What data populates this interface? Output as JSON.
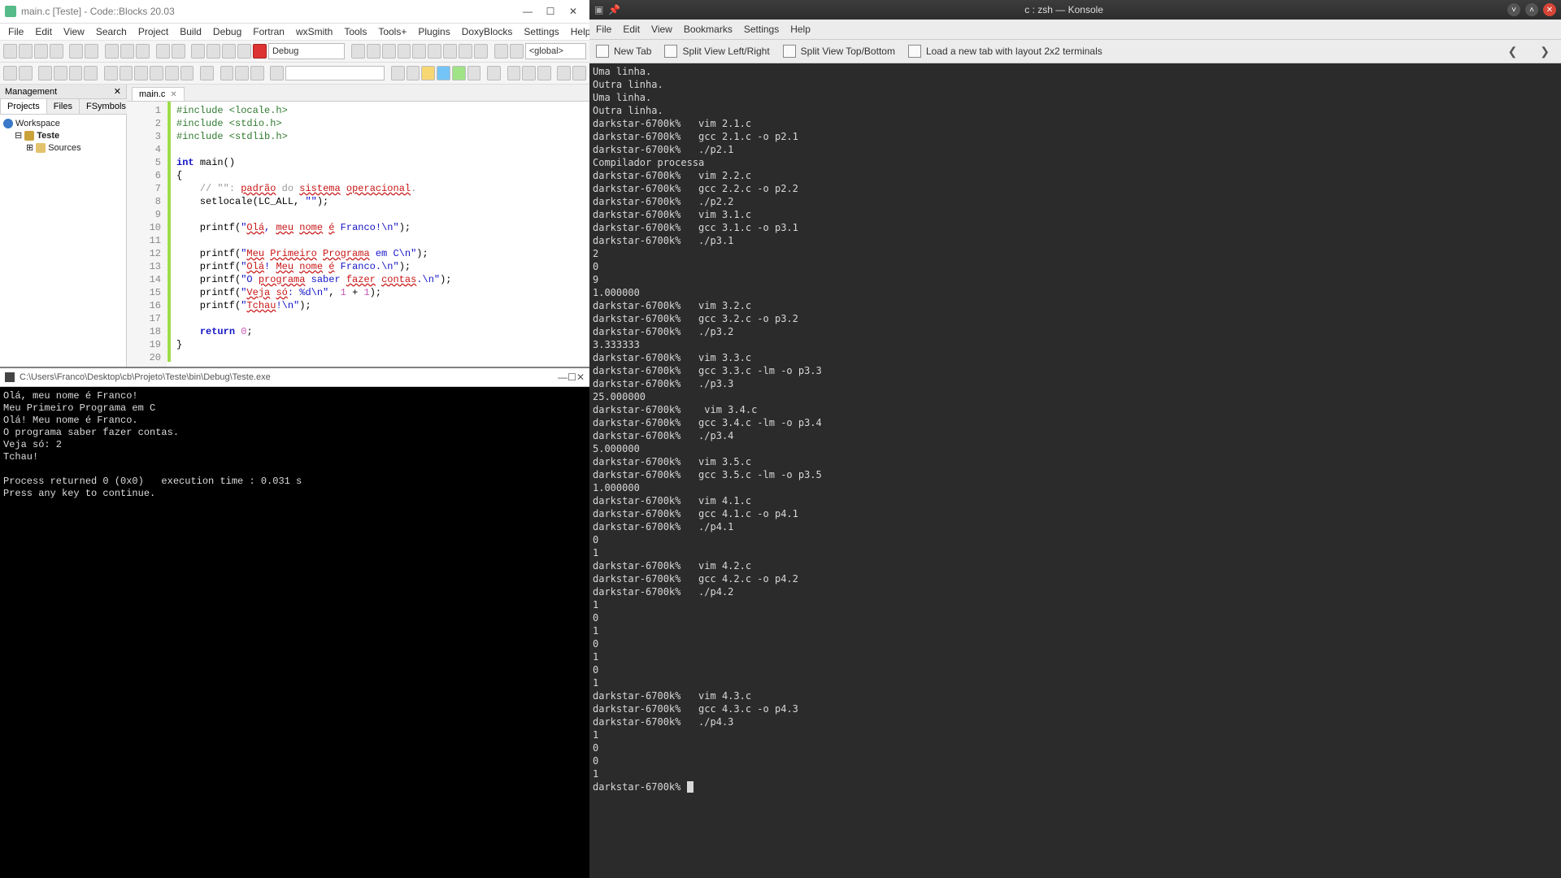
{
  "codeblocks": {
    "title": "main.c [Teste] - Code::Blocks 20.03",
    "menu": [
      "File",
      "Edit",
      "View",
      "Search",
      "Project",
      "Build",
      "Debug",
      "Fortran",
      "wxSmith",
      "Tools",
      "Tools+",
      "Plugins",
      "DoxyBlocks",
      "Settings",
      "Help"
    ],
    "build_target": "Debug",
    "scope_dropdown": "<global>",
    "management": {
      "title": "Management",
      "tabs": [
        "Projects",
        "Files",
        "FSymbols"
      ],
      "active_tab": 0,
      "workspace_label": "Workspace",
      "project_label": "Teste",
      "sources_label": "Sources"
    },
    "file_tab": "main.c",
    "code_lines": [
      {
        "n": 1,
        "html": "<span class='c-pp'>#include &lt;locale.h&gt;</span>"
      },
      {
        "n": 2,
        "html": "<span class='c-pp'>#include &lt;stdio.h&gt;</span>"
      },
      {
        "n": 3,
        "html": "<span class='c-pp'>#include &lt;stdlib.h&gt;</span>"
      },
      {
        "n": 4,
        "html": ""
      },
      {
        "n": 5,
        "html": "<span class='c-kw'>int</span> <span class='c-fn'>main</span>()"
      },
      {
        "n": 6,
        "html": "{"
      },
      {
        "n": 7,
        "html": "    <span class='c-cmt'>// \"\": </span><span class='c-err'>padrão</span><span class='c-cmt'> do </span><span class='c-err'>sistema</span><span class='c-cmt'> </span><span class='c-err'>operacional</span><span class='c-cmt'>.</span>"
      },
      {
        "n": 8,
        "html": "    setlocale(LC_ALL, <span class='c-str'>\"\"</span>);"
      },
      {
        "n": 9,
        "html": ""
      },
      {
        "n": 10,
        "html": "    printf(<span class='c-str'>\"</span><span class='c-err'>Olá</span><span class='c-str'>, </span><span class='c-err'>meu</span><span class='c-str'> </span><span class='c-err'>nome</span><span class='c-str'> </span><span class='c-err'>é</span><span class='c-str'> Franco!\\n\"</span>);"
      },
      {
        "n": 11,
        "html": ""
      },
      {
        "n": 12,
        "html": "    printf(<span class='c-str'>\"</span><span class='c-err'>Meu</span><span class='c-str'> </span><span class='c-err'>Primeiro</span><span class='c-str'> </span><span class='c-err'>Programa</span><span class='c-str'> em C\\n\"</span>);"
      },
      {
        "n": 13,
        "html": "    printf(<span class='c-str'>\"</span><span class='c-err'>Olá</span><span class='c-str'>! </span><span class='c-err'>Meu</span><span class='c-str'> </span><span class='c-err'>nome</span><span class='c-str'> </span><span class='c-err'>é</span><span class='c-str'> Franco.\\n\"</span>);"
      },
      {
        "n": 14,
        "html": "    printf(<span class='c-str'>\"O </span><span class='c-err'>programa</span><span class='c-str'> saber </span><span class='c-err'>fazer</span><span class='c-str'> </span><span class='c-err'>contas</span><span class='c-str'>.\\n\"</span>);"
      },
      {
        "n": 15,
        "html": "    printf(<span class='c-str'>\"</span><span class='c-err'>Veja</span><span class='c-str'> </span><span class='c-err'>só</span><span class='c-str'>: %d\\n\"</span>, <span class='c-num'>1</span> + <span class='c-num'>1</span>);"
      },
      {
        "n": 16,
        "html": "    printf(<span class='c-str'>\"</span><span class='c-err'>Tchau</span><span class='c-str'>!\\n\"</span>);"
      },
      {
        "n": 17,
        "html": ""
      },
      {
        "n": 18,
        "html": "    <span class='c-kw'>return</span> <span class='c-num'>0</span>;"
      },
      {
        "n": 19,
        "html": "}"
      },
      {
        "n": 20,
        "html": ""
      }
    ]
  },
  "console_window": {
    "title": "C:\\Users\\Franco\\Desktop\\cb\\Projeto\\Teste\\bin\\Debug\\Teste.exe",
    "output": "Olá, meu nome é Franco!\nMeu Primeiro Programa em C\nOlá! Meu nome é Franco.\nO programa saber fazer contas.\nVeja só: 2\nTchau!\n\nProcess returned 0 (0x0)   execution time : 0.031 s\nPress any key to continue.\n"
  },
  "konsole": {
    "title": "c : zsh — Konsole",
    "menu": [
      "File",
      "Edit",
      "View",
      "Bookmarks",
      "Settings",
      "Help"
    ],
    "toolbar": {
      "new_tab": "New Tab",
      "splitlr": "Split View Left/Right",
      "splittb": "Split View Top/Bottom",
      "layout": "Load a new tab with layout 2x2 terminals"
    },
    "output": "Uma linha.\nOutra linha.\nUma linha.\nOutra linha.\ndarkstar-6700k%   vim 2.1.c\ndarkstar-6700k%   gcc 2.1.c -o p2.1\ndarkstar-6700k%   ./p2.1\nCompilador processa\ndarkstar-6700k%   vim 2.2.c\ndarkstar-6700k%   gcc 2.2.c -o p2.2\ndarkstar-6700k%   ./p2.2\ndarkstar-6700k%   vim 3.1.c\ndarkstar-6700k%   gcc 3.1.c -o p3.1\ndarkstar-6700k%   ./p3.1\n2\n0\n9\n1.000000\ndarkstar-6700k%   vim 3.2.c\ndarkstar-6700k%   gcc 3.2.c -o p3.2\ndarkstar-6700k%   ./p3.2\n3.333333\ndarkstar-6700k%   vim 3.3.c\ndarkstar-6700k%   gcc 3.3.c -lm -o p3.3\ndarkstar-6700k%   ./p3.3\n25.000000\ndarkstar-6700k%    vim 3.4.c\ndarkstar-6700k%   gcc 3.4.c -lm -o p3.4\ndarkstar-6700k%   ./p3.4\n5.000000\ndarkstar-6700k%   vim 3.5.c\ndarkstar-6700k%   gcc 3.5.c -lm -o p3.5\n1.000000\ndarkstar-6700k%   vim 4.1.c\ndarkstar-6700k%   gcc 4.1.c -o p4.1\ndarkstar-6700k%   ./p4.1\n0\n1\ndarkstar-6700k%   vim 4.2.c\ndarkstar-6700k%   gcc 4.2.c -o p4.2\ndarkstar-6700k%   ./p4.2\n1\n0\n1\n0\n1\n0\n1\ndarkstar-6700k%   vim 4.3.c\ndarkstar-6700k%   gcc 4.3.c -o p4.3\ndarkstar-6700k%   ./p4.3\n1\n0\n0\n1\ndarkstar-6700k% "
  }
}
